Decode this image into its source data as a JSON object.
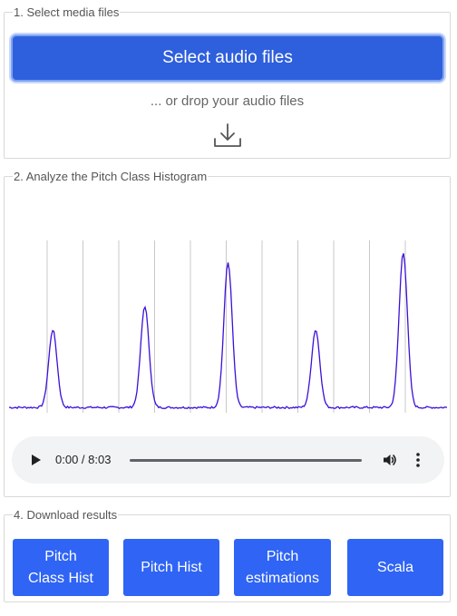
{
  "section1": {
    "legend": "1. Select media files",
    "select_button": "Select audio files",
    "drop_text": "... or drop your audio files",
    "drop_icon": "download-tray-icon"
  },
  "section2": {
    "legend": "2. Analyze the Pitch Class Histogram",
    "line_color": "#3d0fd9",
    "grid_color": "#c8c8c8",
    "peaks": [
      {
        "x": 0.1,
        "height": 0.46
      },
      {
        "x": 0.31,
        "height": 0.6
      },
      {
        "x": 0.5,
        "height": 0.86
      },
      {
        "x": 0.7,
        "height": 0.46
      },
      {
        "x": 0.9,
        "height": 0.92
      }
    ],
    "audio": {
      "time": "0:00 / 8:03",
      "play_icon": "play-icon",
      "volume_icon": "volume-icon",
      "more_icon": "more-vertical-icon"
    }
  },
  "section4": {
    "legend": "4. Download results",
    "buttons": [
      "Pitch\nClass Hist",
      "Pitch Hist",
      "Pitch\nestimations",
      "Scala"
    ],
    "button_color": "#2f64f5"
  }
}
